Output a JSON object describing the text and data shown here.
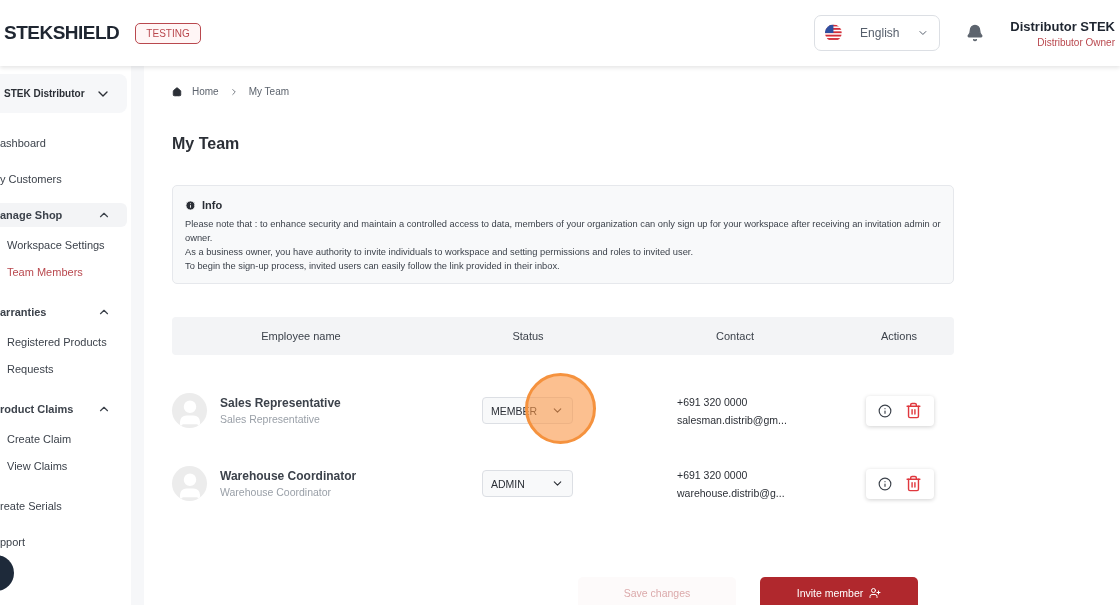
{
  "header": {
    "logo": "STEKSHIELD",
    "env_badge": "TESTING",
    "language": "English",
    "user_name": "Distributor STEK",
    "user_role": "Distributor Owner"
  },
  "sidebar": {
    "workspace": "STEK Distributor",
    "items": [
      {
        "kind": "link",
        "label": "ashboard",
        "selected": false
      },
      {
        "kind": "link",
        "label": "y Customers",
        "selected": false
      },
      {
        "kind": "group",
        "label": "anage Shop",
        "expanded": true,
        "highlighted": true,
        "children": [
          {
            "label": "Workspace Settings",
            "selected": false
          },
          {
            "label": "Team Members",
            "selected": true
          }
        ]
      },
      {
        "kind": "group",
        "label": "arranties",
        "expanded": true,
        "highlighted": false,
        "children": [
          {
            "label": "Registered Products",
            "selected": false
          },
          {
            "label": "Requests",
            "selected": false
          }
        ]
      },
      {
        "kind": "group",
        "label": "roduct Claims",
        "expanded": true,
        "highlighted": false,
        "children": [
          {
            "label": "Create Claim",
            "selected": false
          },
          {
            "label": "View Claims",
            "selected": false
          }
        ]
      },
      {
        "kind": "link",
        "label": "reate Serials",
        "selected": false
      },
      {
        "kind": "link",
        "label": "pport",
        "selected": false
      }
    ]
  },
  "breadcrumb": [
    "Home",
    "My Team"
  ],
  "title": "My Team",
  "info": {
    "title": "Info",
    "lines": [
      "Please note that : to enhance security and maintain a controlled access to data, members of your organization can only sign up for your workspace after receiving an invitation admin or owner.",
      "As a business owner, you have authority to invite individuals to workspace and setting permissions and roles to invited user.",
      "To begin the sign-up process, invited users can easily follow the link provided in their inbox."
    ]
  },
  "table": {
    "columns": [
      "Employee name",
      "Status",
      "Contact",
      "Actions"
    ],
    "rows": [
      {
        "name": "Sales Representative",
        "role": "Sales Representative",
        "status": "MEMBER",
        "phone": "+691 320 0000",
        "email": "salesman.distrib@gm..."
      },
      {
        "name": "Warehouse Coordinator",
        "role": "Warehouse Coordinator",
        "status": "ADMIN",
        "phone": "+691 320 0000",
        "email": "warehouse.distrib@g..."
      }
    ]
  },
  "buttons": [
    {
      "label": "Save changes",
      "disabled": true
    },
    {
      "label": "Invite member",
      "disabled": false
    }
  ]
}
